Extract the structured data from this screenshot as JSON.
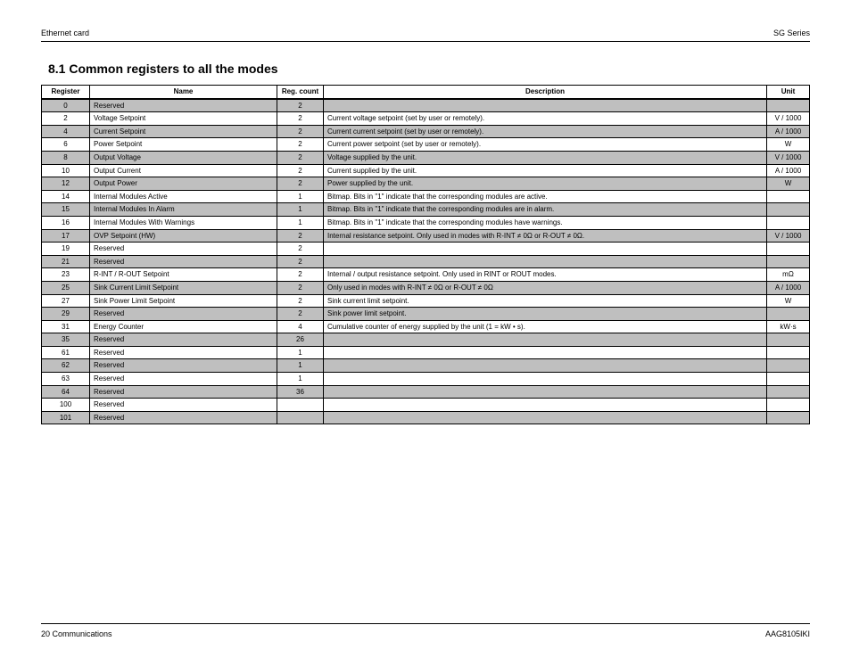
{
  "runhead": {
    "left": "Ethernet card",
    "right": "SG Series"
  },
  "title": "8.1  Common registers to all the modes",
  "columns": {
    "reg": "Register",
    "name": "Name",
    "count": "Reg. count",
    "desc": "Description",
    "unit": "Unit"
  },
  "rows": [
    {
      "shade": true,
      "reg": "0",
      "name": "Reserved",
      "count": "2",
      "desc": "",
      "unit": ""
    },
    {
      "shade": false,
      "reg": "2",
      "name": "Voltage Setpoint",
      "count": "2",
      "desc": "Current voltage setpoint (set by user or remotely).",
      "unit": "V / 1000"
    },
    {
      "shade": true,
      "reg": "4",
      "name": "Current Setpoint",
      "count": "2",
      "desc": "Current current setpoint (set by user or remotely).",
      "unit": "A / 1000"
    },
    {
      "shade": false,
      "reg": "6",
      "name": "Power Setpoint",
      "count": "2",
      "desc": "Current power setpoint (set by user or remotely).",
      "unit": "W"
    },
    {
      "shade": true,
      "reg": "8",
      "name": "Output Voltage",
      "count": "2",
      "desc": "Voltage supplied by the unit.",
      "unit": "V / 1000"
    },
    {
      "shade": false,
      "reg": "10",
      "name": "Output Current",
      "count": "2",
      "desc": "Current supplied by the unit.",
      "unit": "A / 1000"
    },
    {
      "shade": true,
      "reg": "12",
      "name": "Output Power",
      "count": "2",
      "desc": "Power supplied by the unit.",
      "unit": "W"
    },
    {
      "shade": false,
      "reg": "14",
      "name": "Internal Modules Active",
      "count": "1",
      "desc": "Bitmap. Bits in \"1\" indicate that the corresponding modules are active.",
      "unit": ""
    },
    {
      "shade": true,
      "reg": "15",
      "name": "Internal Modules In Alarm",
      "count": "1",
      "desc": "Bitmap. Bits in \"1\" indicate that the corresponding modules are in alarm.",
      "unit": ""
    },
    {
      "shade": false,
      "reg": "16",
      "name": "Internal Modules With Warnings",
      "count": "1",
      "desc": "Bitmap. Bits in \"1\" indicate that the corresponding modules have warnings.",
      "unit": ""
    },
    {
      "shade": true,
      "reg": "17",
      "name": "OVP Setpoint (HW)",
      "count": "2",
      "desc": "Internal resistance setpoint. Only used in modes with R-INT ≠ 0Ω or R-OUT ≠ 0Ω.",
      "unit": "V / 1000"
    },
    {
      "shade": false,
      "reg": "19",
      "name": "Reserved",
      "count": "2",
      "desc": "",
      "unit": ""
    },
    {
      "shade": true,
      "reg": "21",
      "name": "Reserved",
      "count": "2",
      "desc": "",
      "unit": ""
    },
    {
      "shade": false,
      "reg": "23",
      "name": "R-INT / R-OUT Setpoint",
      "count": "2",
      "desc": "Internal / output resistance setpoint. Only used in RINT or ROUT modes.",
      "unit": "mΩ"
    },
    {
      "shade": true,
      "reg": "25",
      "name": "Sink Current Limit Setpoint",
      "count": "2",
      "desc": "Only used in modes with R-INT ≠ 0Ω or R-OUT ≠ 0Ω",
      "unit": "A / 1000"
    },
    {
      "shade": false,
      "reg": "27",
      "name": "Sink Power Limit Setpoint",
      "count": "2",
      "desc": "Sink current limit setpoint.",
      "unit": "W"
    },
    {
      "shade": true,
      "reg": "29",
      "name": "Reserved",
      "count": "2",
      "desc": "Sink power limit setpoint.",
      "unit": ""
    },
    {
      "shade": false,
      "reg": "31",
      "name": "Energy Counter",
      "count": "4",
      "desc": "Cumulative counter of energy supplied by the unit (1 = kW • s).",
      "unit": "kW·s"
    },
    {
      "shade": true,
      "reg": "35",
      "name": "Reserved",
      "count": "26",
      "desc": "",
      "unit": ""
    },
    {
      "shade": false,
      "reg": "61",
      "name": "Reserved",
      "count": "1",
      "desc": "",
      "unit": ""
    },
    {
      "shade": true,
      "reg": "62",
      "name": "Reserved",
      "count": "1",
      "desc": "",
      "unit": ""
    },
    {
      "shade": false,
      "reg": "63",
      "name": "Reserved",
      "count": "1",
      "desc": "",
      "unit": ""
    },
    {
      "shade": true,
      "reg": "64",
      "name": "Reserved",
      "count": "36",
      "desc": "",
      "unit": ""
    },
    {
      "shade": false,
      "reg": "100",
      "name": "Reserved",
      "count": "",
      "desc": "",
      "unit": ""
    },
    {
      "shade": true,
      "reg": "101",
      "name": "Reserved",
      "count": "",
      "desc": "",
      "unit": ""
    }
  ],
  "footer": {
    "left": "20  Communications",
    "right": "AAG8105IKI"
  }
}
